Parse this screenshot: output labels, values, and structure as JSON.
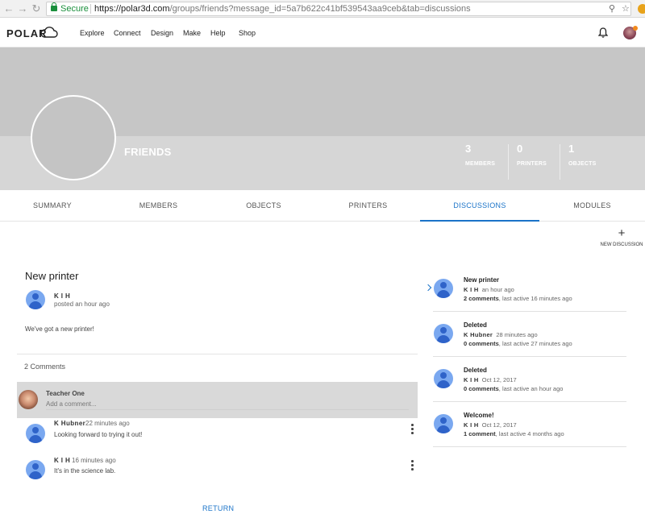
{
  "browser": {
    "secure_label": "Secure",
    "url_scheme": "https://",
    "url_host": "polar3d.com",
    "url_path": "/groups/friends?message_id=5a7b622c41bf539543aa9ceb&tab=discussions"
  },
  "header": {
    "logo": "POLAR",
    "nav": [
      "Explore",
      "Connect",
      "Design",
      "Make",
      "Help",
      "Shop"
    ]
  },
  "group": {
    "name": "FRIENDS",
    "stats": [
      {
        "value": "3",
        "label": "MEMBERS"
      },
      {
        "value": "0",
        "label": "PRINTERS"
      },
      {
        "value": "1",
        "label": "OBJECTS"
      }
    ]
  },
  "tabs": [
    "SUMMARY",
    "MEMBERS",
    "OBJECTS",
    "PRINTERS",
    "DISCUSSIONS",
    "MODULES"
  ],
  "active_tab": "DISCUSSIONS",
  "new_discussion_label": "NEW DISCUSSION",
  "message": {
    "title": "New printer",
    "author": "K I H",
    "posted": "posted an hour ago",
    "body": "We've got a new printer!",
    "comments_count": "2 Comments"
  },
  "compose": {
    "user": "Teacher One",
    "placeholder": "Add a comment..."
  },
  "comments": [
    {
      "author": "K Hubner",
      "time": "22 minutes ago",
      "text": "Looking forward to trying it out!"
    },
    {
      "author": "K I H",
      "time": "16 minutes ago",
      "text": "It's in the science lab."
    }
  ],
  "return_label": "RETURN",
  "discussions": [
    {
      "title": "New printer",
      "author": "K I H",
      "time": "an hour ago",
      "comments": "2 comments",
      "activity": ", last active 16 minutes ago"
    },
    {
      "title": "Deleted",
      "author": "K Hubner",
      "time": "28 minutes ago",
      "comments": "0 comments",
      "activity": ", last active 27 minutes ago"
    },
    {
      "title": "Deleted",
      "author": "K I H",
      "time": "Oct 12, 2017",
      "comments": "0 comments",
      "activity": ", last active an hour ago"
    },
    {
      "title": "Welcome!",
      "author": "K I H",
      "time": "Oct 12, 2017",
      "comments": "1 comment",
      "activity": ", last active 4 months ago"
    }
  ],
  "colors": {
    "accent": "#1a73c8",
    "banner": "#c6c6c6",
    "avatar": "#7aa8f0"
  }
}
